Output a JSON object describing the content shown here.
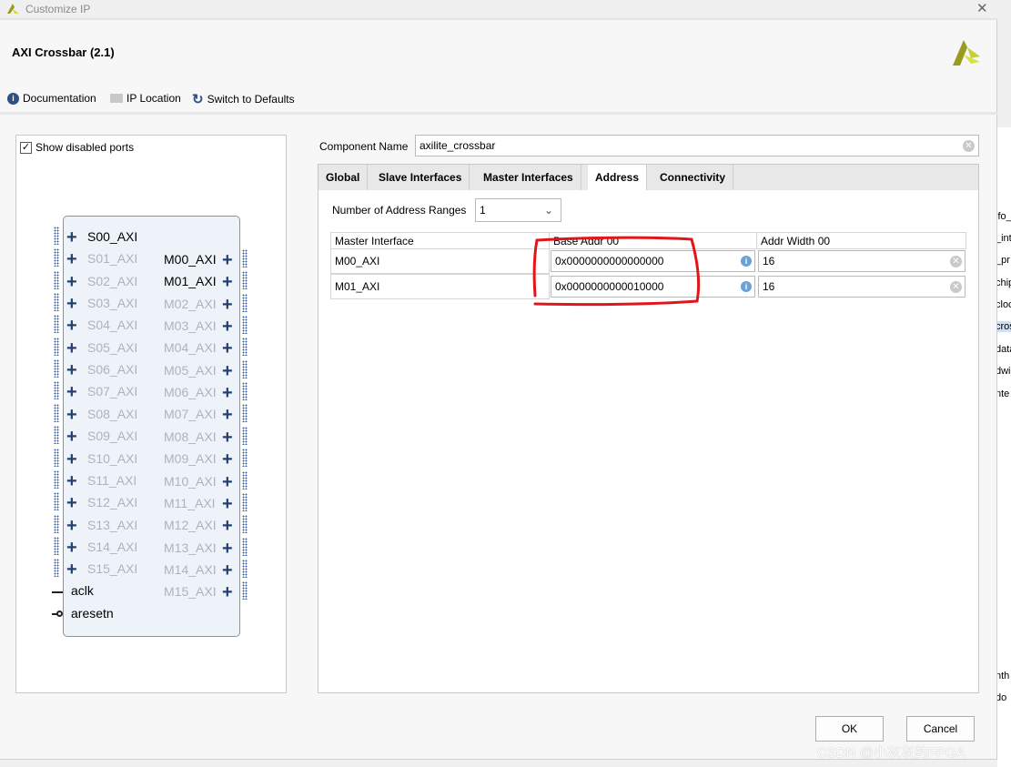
{
  "window": {
    "title": "Customize IP",
    "close": "✕"
  },
  "header": {
    "ip_name": "AXI Crossbar (2.1)"
  },
  "toolbar": {
    "documentation": "Documentation",
    "ip_location": "IP Location",
    "switch_defaults": "Switch to Defaults"
  },
  "diagram": {
    "show_disabled_label": "Show disabled ports",
    "show_disabled_checked": true,
    "slave_ports": [
      "S00_AXI",
      "S01_AXI",
      "S02_AXI",
      "S03_AXI",
      "S04_AXI",
      "S05_AXI",
      "S06_AXI",
      "S07_AXI",
      "S08_AXI",
      "S09_AXI",
      "S10_AXI",
      "S11_AXI",
      "S12_AXI",
      "S13_AXI",
      "S14_AXI",
      "S15_AXI"
    ],
    "master_ports": [
      "M00_AXI",
      "M01_AXI",
      "M02_AXI",
      "M03_AXI",
      "M04_AXI",
      "M05_AXI",
      "M06_AXI",
      "M07_AXI",
      "M08_AXI",
      "M09_AXI",
      "M10_AXI",
      "M11_AXI",
      "M12_AXI",
      "M13_AXI",
      "M14_AXI",
      "M15_AXI"
    ],
    "enabled_slaves": 1,
    "enabled_masters": 2,
    "clock": "aclk",
    "reset": "aresetn"
  },
  "config": {
    "component_name_label": "Component Name",
    "component_name": "axilite_crossbar",
    "tabs": [
      "Global",
      "Slave Interfaces",
      "Master Interfaces",
      "Address",
      "Connectivity"
    ],
    "active_tab": "Address",
    "num_ranges_label": "Number of Address Ranges",
    "num_ranges": "1",
    "columns": [
      "Master Interface",
      "Base Addr 00",
      "Addr Width 00"
    ],
    "rows": [
      {
        "iface": "M00_AXI",
        "base": "0x0000000000000000",
        "width": "16"
      },
      {
        "iface": "M01_AXI",
        "base": "0x0000000000010000",
        "width": "16"
      }
    ],
    "annotation_color": "#e0161b"
  },
  "buttons": {
    "ok": "OK",
    "cancel": "Cancel"
  },
  "background_fragments": [
    "ifo_",
    "_int",
    "_pr",
    "chip",
    "cloc",
    "cros",
    "data",
    "dwi",
    "nte",
    "nth",
    "do"
  ],
  "watermark": "CSDN @小灰灰的FPGA"
}
